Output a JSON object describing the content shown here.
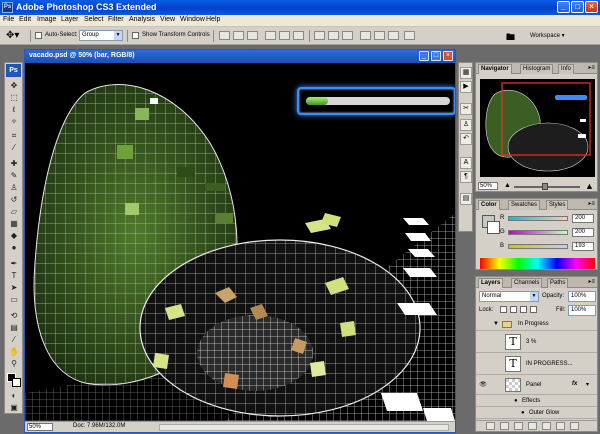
{
  "window": {
    "title": "Adobe Photoshop CS3 Extended",
    "logo": "Ps",
    "min": "_",
    "max": "□",
    "close": "×"
  },
  "menu": [
    "File",
    "Edit",
    "Image",
    "Layer",
    "Select",
    "Filter",
    "Analysis",
    "View",
    "Window",
    "Help"
  ],
  "options": {
    "auto_select_label": "Auto-Select:",
    "auto_select_value": "Group",
    "show_transform_label": "Show Transform Controls",
    "workspace_label": "Workspace ▾"
  },
  "document": {
    "title": "vacado.psd @ 50% (bar, RGB/8)",
    "status_zoom": "50%",
    "status_doc": "Doc: 7.96M/132.0M",
    "progress": 0.15
  },
  "navigator": {
    "tabs": [
      "Navigator",
      "Histogram",
      "Info"
    ],
    "zoom": "50%"
  },
  "color": {
    "tabs": [
      "Color",
      "Swatches",
      "Styles"
    ],
    "channels": [
      {
        "name": "R",
        "value": "200"
      },
      {
        "name": "G",
        "value": "200"
      },
      {
        "name": "B",
        "value": "193"
      }
    ],
    "foreground": "#c8c8c1",
    "background": "#ffffff"
  },
  "layers": {
    "tabs": [
      "Layers",
      "Channels",
      "Paths"
    ],
    "blend_mode": "Normal",
    "opacity_label": "Opacity:",
    "opacity": "100%",
    "lock_label": "Lock:",
    "fill_label": "Fill:",
    "fill": "100%",
    "rows": {
      "group": "In Progress",
      "layer1": "3 %",
      "layer2": "IN PROGRESS...",
      "layer3": "Panel",
      "effects": "Effects",
      "outer_glow": "Outer Glow"
    },
    "thumb_letter": "T",
    "fx": "fx"
  }
}
